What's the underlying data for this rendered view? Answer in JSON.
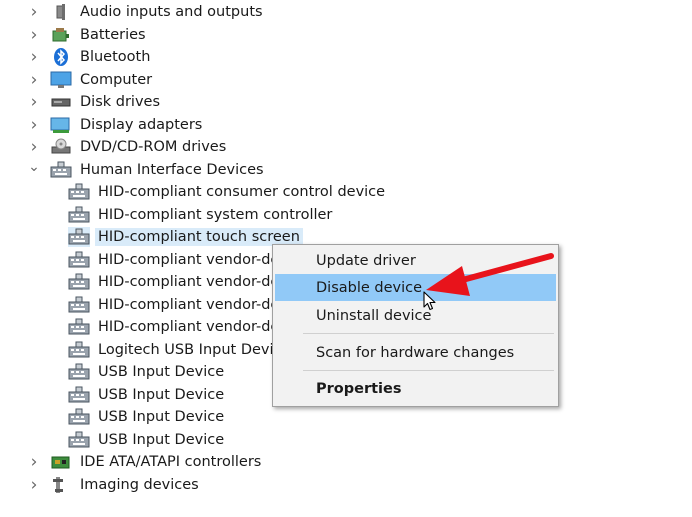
{
  "tree": {
    "categories_top": [
      {
        "label": "Audio inputs and outputs",
        "icon": "speaker-icon"
      },
      {
        "label": "Batteries",
        "icon": "battery-icon"
      },
      {
        "label": "Bluetooth",
        "icon": "bluetooth-icon"
      },
      {
        "label": "Computer",
        "icon": "monitor-icon"
      },
      {
        "label": "Disk drives",
        "icon": "disk-drive-icon"
      },
      {
        "label": "Display adapters",
        "icon": "display-adapter-icon"
      },
      {
        "label": "DVD/CD-ROM drives",
        "icon": "dvd-drive-icon"
      }
    ],
    "expanded_category": {
      "label": "Human Interface Devices",
      "icon": "hid-icon"
    },
    "hid_children": [
      "HID-compliant consumer control device",
      "HID-compliant system controller",
      "HID-compliant touch screen",
      "HID-compliant vendor-defi",
      "HID-compliant vendor-defi",
      "HID-compliant vendor-defi",
      "HID-compliant vendor-defi",
      "Logitech USB Input Device",
      "USB Input Device",
      "USB Input Device",
      "USB Input Device",
      "USB Input Device"
    ],
    "categories_bottom": [
      {
        "label": "IDE ATA/ATAPI controllers",
        "icon": "ide-controller-icon"
      },
      {
        "label": "Imaging devices",
        "icon": "camera-icon"
      }
    ]
  },
  "context_menu": {
    "items": {
      "update": "Update driver",
      "disable": "Disable device",
      "uninstall": "Uninstall device",
      "scan": "Scan for hardware changes",
      "properties": "Properties"
    }
  },
  "colors": {
    "selection": "#d9ebf9",
    "menu_highlight": "#91c9f7",
    "arrow": "#e8131b"
  }
}
